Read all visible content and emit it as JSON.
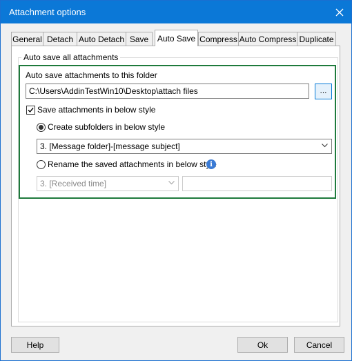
{
  "window": {
    "title": "Attachment options",
    "close_icon": "close-icon"
  },
  "tabs": [
    {
      "label": "General"
    },
    {
      "label": "Detach"
    },
    {
      "label": "Auto Detach"
    },
    {
      "label": "Save"
    },
    {
      "label": "Auto Save",
      "active": true
    },
    {
      "label": "Compress"
    },
    {
      "label": "Auto Compress"
    },
    {
      "label": "Duplicate"
    }
  ],
  "auto_save": {
    "group_label": "Auto save all attachments",
    "folder_label": "Auto save attachments to this folder",
    "folder_path": "C:\\Users\\AddinTestWin10\\Desktop\\attach files",
    "browse_label": "...",
    "save_style_label": "Save attachments in below style",
    "save_style_checked": true,
    "subfolder_label": "Create subfolders in below style",
    "subfolder_selected": true,
    "subfolder_style_value": "3. [Message folder]-[message subject]",
    "rename_label": "Rename the saved attachments in below style",
    "rename_selected": false,
    "rename_style_value": "3. [Received time]",
    "rename_extra_value": "",
    "info_icon": "info-icon",
    "info_glyph": "i"
  },
  "footer": {
    "help_label": "Help",
    "ok_label": "Ok",
    "cancel_label": "Cancel"
  },
  "colors": {
    "titlebar": "#0b78d7",
    "highlight_border": "#1e7a3c",
    "info": "#3a7bd5"
  }
}
